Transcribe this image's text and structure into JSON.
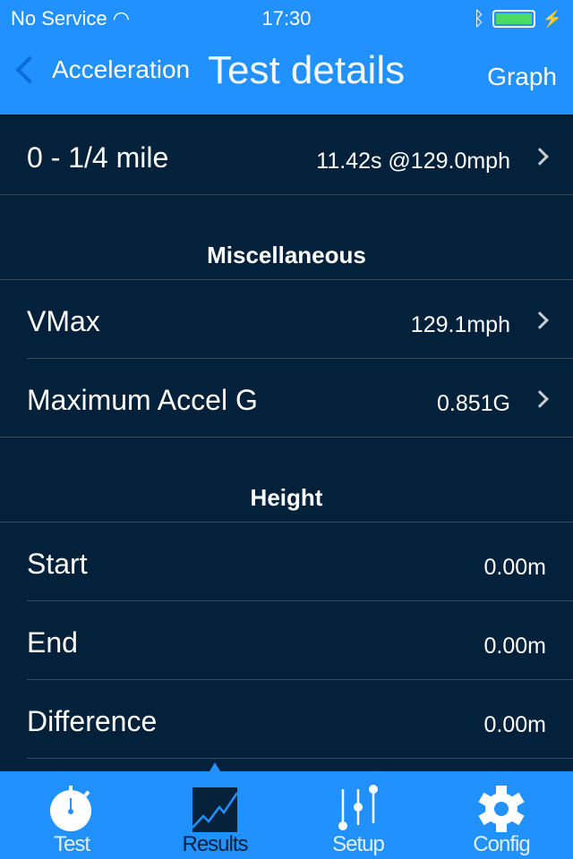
{
  "status": {
    "carrier": "No Service",
    "time": "17:30"
  },
  "nav": {
    "back_label": "Acceleration",
    "title": "Test details",
    "right_label": "Graph"
  },
  "rows_top": [
    {
      "label": "0 - 1/4 mile",
      "value": "11.42s @129.0mph"
    }
  ],
  "sections": [
    {
      "title": "Miscellaneous",
      "rows": [
        {
          "label": "VMax",
          "value": "129.1mph"
        },
        {
          "label": "Maximum Accel G",
          "value": "0.851G"
        }
      ]
    },
    {
      "title": "Height",
      "rows": [
        {
          "label": "Start",
          "value": "0.00m"
        },
        {
          "label": "End",
          "value": "0.00m"
        },
        {
          "label": "Difference",
          "value": "0.00m"
        }
      ]
    }
  ],
  "tabs": [
    {
      "label": "Test",
      "icon": "stopwatch-icon"
    },
    {
      "label": "Results",
      "icon": "chart-icon",
      "active": true
    },
    {
      "label": "Setup",
      "icon": "sliders-icon"
    },
    {
      "label": "Config",
      "icon": "gear-icon"
    }
  ],
  "colors": {
    "accent": "#2091ff",
    "background": "#03213a",
    "battery": "#4cd964"
  }
}
